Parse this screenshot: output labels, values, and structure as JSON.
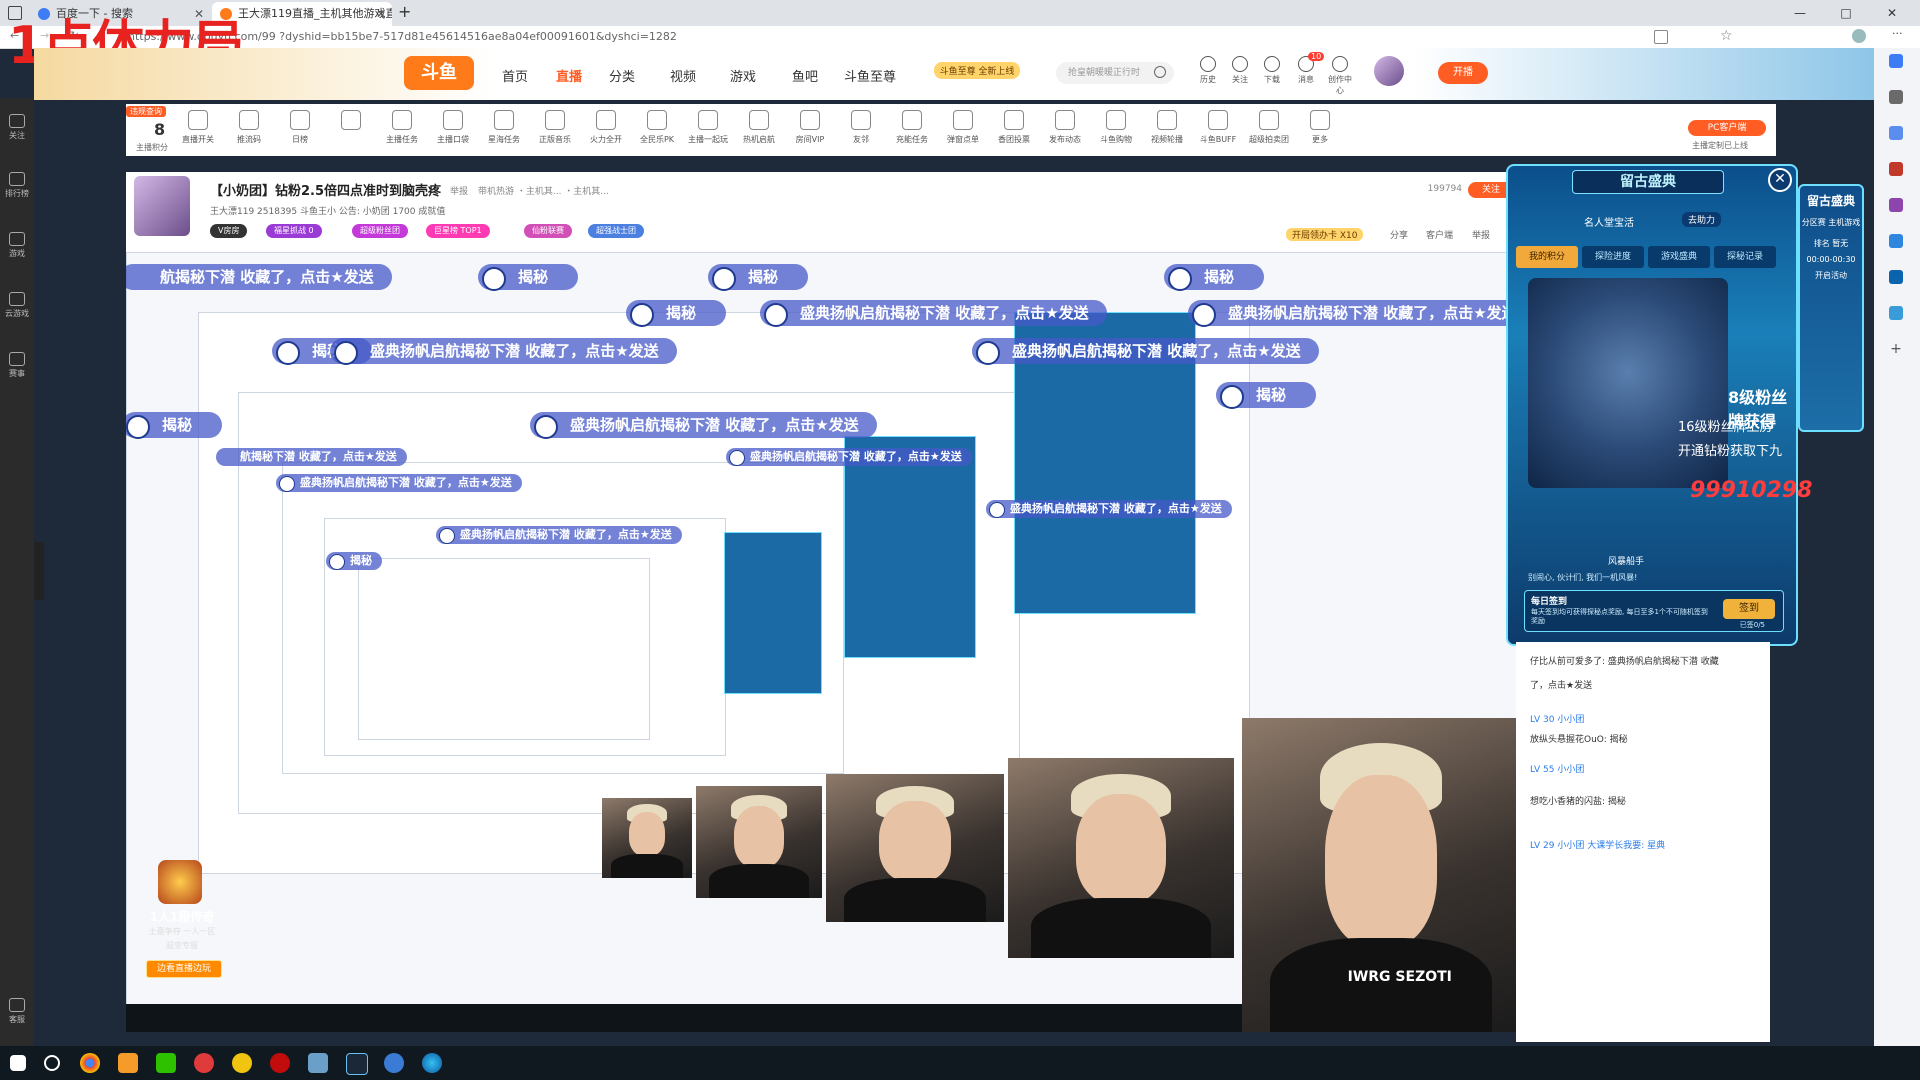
{
  "overlay_title": "1点体力局",
  "browser": {
    "tabs": [
      {
        "label": "百度一下 - 搜索",
        "active": false
      },
      {
        "label": "王大漂119直播_主机其他游戏直",
        "active": true
      }
    ],
    "new_tab": "+",
    "url": "https://www.douyu.com/99  ?dyshid=bb15be7-517d81e45614516ae8a04ef00091601&dyshci=1282",
    "win_controls": [
      "—",
      "□",
      "✕"
    ]
  },
  "left_sidebar": [
    "关注",
    "排行榜",
    "游戏",
    "云游戏",
    "赛事",
    "客服"
  ],
  "douyu_header": {
    "logo": "斗鱼",
    "nav": [
      "首页",
      "直播",
      "分类",
      "视频",
      "游戏",
      "鱼吧",
      "斗鱼至尊"
    ],
    "active_nav": "直播",
    "promo": "斗鱼至尊 全新上线",
    "search_placeholder": "抢皇朝暖暖正行时",
    "icons": [
      "历史",
      "关注",
      "下载",
      "消息",
      "创作中心"
    ],
    "notif_count": "10",
    "kaibo": "开播"
  },
  "toolbar": {
    "score_label": "主播积分",
    "score_value": "8",
    "score_tag": "违规查询",
    "items": [
      "直播开关",
      "推流码",
      "日榜",
      "",
      "主播任务",
      "主播口袋",
      "星海任务",
      "正版音乐",
      "火力全开",
      "全民乐PK",
      "主播一起玩",
      "热机启航",
      "房间VIP",
      "友邻",
      "充能任务",
      "弹窗点单",
      "香团投票",
      "发布动态",
      "斗鱼购物",
      "视频轮播",
      "斗鱼BUFF",
      "超级拍卖团",
      "更多"
    ],
    "pc_client": "PC客户端",
    "pc_client_sub": "主播定制已上线"
  },
  "room": {
    "title": "【小奶团】钻粉2.5倍四点准时到脑壳疼",
    "tags": [
      "举报",
      "带机热游 ・主机其... ・主机其..."
    ],
    "meta": "王大漂119  2518395  斗鱼王小  公告: 小奶团  1700 成就值",
    "followers": "199794",
    "follow": "关注",
    "badges": [
      "V房房",
      "福星抓战 0",
      "超级粉丝团",
      "巨星榜 TOP1",
      "仙粉联赛",
      "超强战士团"
    ],
    "right_links": [
      "开局领办卡 X10",
      "分享",
      "客户端",
      "举报"
    ]
  },
  "danmu": {
    "text_long": "盛典扬帆启航揭秘下潜 收藏了，点击★发送",
    "text_part": "航揭秘下潜 收藏了，点击★发送",
    "text_short": "揭秘"
  },
  "event": {
    "title": "留古盛典",
    "sub1": "名人堂宝活",
    "sub2": "去助力",
    "tabs": [
      "我的积分",
      "探险进度",
      "游戏盛典",
      "探秘记录"
    ],
    "text1": "8级粉丝牌获得",
    "text2": "16级粉丝牌上房",
    "text3": "开通钻粉获取下九",
    "big_number": "99910298",
    "sign_title": "每日签到",
    "sign_desc": "每天签到均可获得探秘点奖励, 每日至多1个不可随机签到奖励",
    "sign_btn": "签到",
    "sign_sub": "已签0/5",
    "wind_title": "风暴船手",
    "wind_desc": "别闹心, 伙计们, 我们一机风暴!",
    "side": {
      "title": "留古盛典",
      "zone": "分区赛 主机游戏",
      "rank": "排名 暂无",
      "time": "00:00-00:30",
      "tip": "开启活动"
    }
  },
  "chat": {
    "lines": [
      {
        "text": "仔比从前可爱多了:  盛典扬帆启航揭秘下潜 收藏",
        "lv": ""
      },
      {
        "text": "了，点击★发送",
        "lv": ""
      },
      {
        "text": "LV 30  小小团  ",
        "lv": "LV 30"
      },
      {
        "text": "放纵头悬握花OuO:  揭秘",
        "lv": ""
      },
      {
        "text": "LV 55  小小团  ",
        "lv": "LV 55"
      },
      {
        "text": "想吃小香猪的闪盐:  揭秘",
        "lv": ""
      },
      {
        "text": "LV 29  小小团  大课学长我要:  星典",
        "lv": "LV 29"
      }
    ]
  },
  "game_ad": {
    "name": "1人1服传奇",
    "line1": "土豪争夺  一人一区",
    "line2": "超变专服",
    "button": "边看直播边玩"
  },
  "cam_shirt": "IWRG SEZOTI",
  "taskbar": [
    "start",
    "search",
    "chrome",
    "app-orange",
    "wechat",
    "app-red",
    "app-yellow",
    "netease",
    "app-2",
    "steam",
    "app-blue",
    "edge"
  ]
}
